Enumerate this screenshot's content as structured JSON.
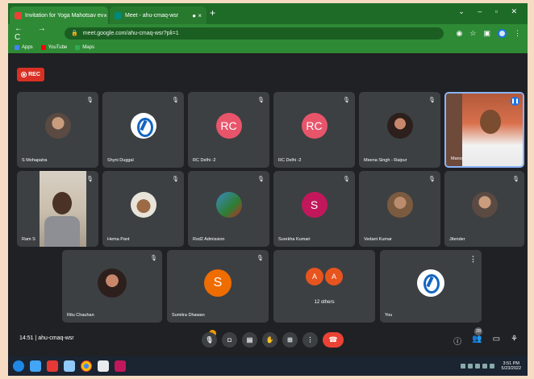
{
  "browser": {
    "tabs": [
      {
        "label": "Invitation for Yoga Mahotsav ev",
        "close": "×"
      },
      {
        "label": "Meet - ahu-cmaq-wsr",
        "close": "● ×"
      }
    ],
    "new_tab": "+",
    "window_controls": "⌄ – ▫ ✕",
    "nav": "← → C",
    "url": "meet.google.com/ahu-cmaq-wsr?pli=1",
    "bookmarks": [
      {
        "label": "Apps",
        "color": "#4285f4"
      },
      {
        "label": "YouTube",
        "color": "#ff0000"
      },
      {
        "label": "Maps",
        "color": "#34a853"
      }
    ]
  },
  "meeting": {
    "rec_label": "REC",
    "participants": [
      {
        "name": "S Mohapatra",
        "avatar": "photo"
      },
      {
        "name": "Shyni Duggal",
        "avatar": "logo"
      },
      {
        "name": "RC Delhi -2",
        "initials": "RC",
        "color": "#e8556b"
      },
      {
        "name": "RC Delhi -2",
        "initials": "RC",
        "color": "#e8556b"
      },
      {
        "name": "Meena Singh - Raipur",
        "avatar": "photo"
      },
      {
        "name": "Manoj",
        "avatar": "video"
      },
      {
        "name": "Ram S",
        "avatar": "video"
      },
      {
        "name": "Hema Pant",
        "avatar": "photo"
      },
      {
        "name": "Rsd2 Admission",
        "avatar": "photo"
      },
      {
        "name": "Surekha Kumari",
        "initials": "S",
        "color": "#c2185b"
      },
      {
        "name": "Vedant Kumar",
        "avatar": "photo"
      },
      {
        "name": "Jitender",
        "avatar": "photo"
      },
      {
        "name": "Ritu Chauhan",
        "avatar": "photo"
      },
      {
        "name": "Sumitra Dhawan",
        "initials": "S",
        "color": "#ef6c00"
      },
      {
        "name": "12 others",
        "initials": "A",
        "color": "#e8541e"
      },
      {
        "name": "You",
        "avatar": "logo"
      }
    ],
    "meeting_time": "14:51",
    "meeting_code": "ahu-cmaq-wsr",
    "participant_count": "28"
  },
  "taskbar": {
    "time": "3:51 PM",
    "date": "5/23/2022"
  }
}
